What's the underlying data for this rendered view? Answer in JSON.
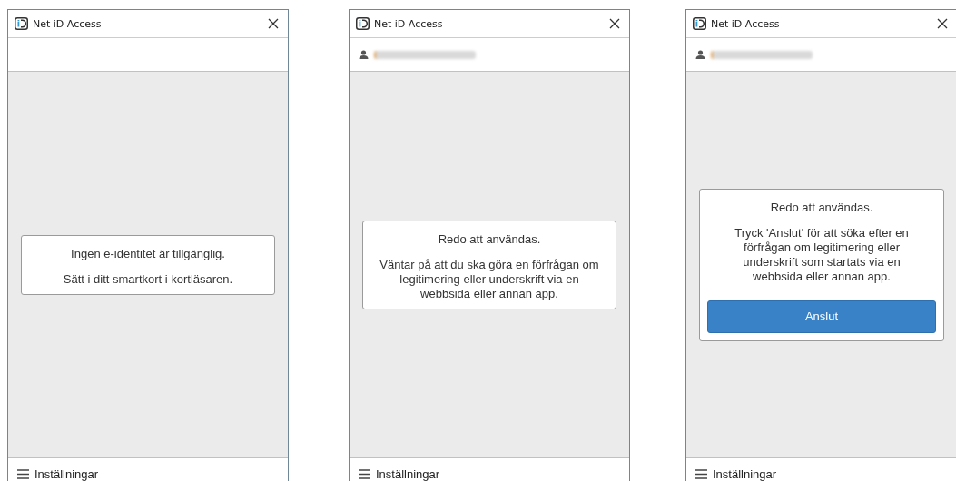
{
  "windows": [
    {
      "title": "Net iD Access",
      "user_shown": false,
      "message": {
        "heading": "Ingen e-identitet är tillgänglig.",
        "body": "Sätt i ditt smartkort i kortläsaren."
      },
      "footer": "Inställningar"
    },
    {
      "title": "Net iD Access",
      "user_shown": true,
      "message": {
        "heading": "Redo att användas.",
        "body": "Väntar på att du ska göra en förfrågan om legitimering eller underskrift via en webbsida eller annan app."
      },
      "footer": "Inställningar"
    },
    {
      "title": "Net iD Access",
      "user_shown": true,
      "message": {
        "heading": "Redo att användas.",
        "body": "Tryck 'Anslut' för att söka efter en förfrågan om legitimering eller underskrift som startats via en webbsida eller annan app.",
        "button": "Anslut"
      },
      "footer": "Inställningar"
    }
  ]
}
